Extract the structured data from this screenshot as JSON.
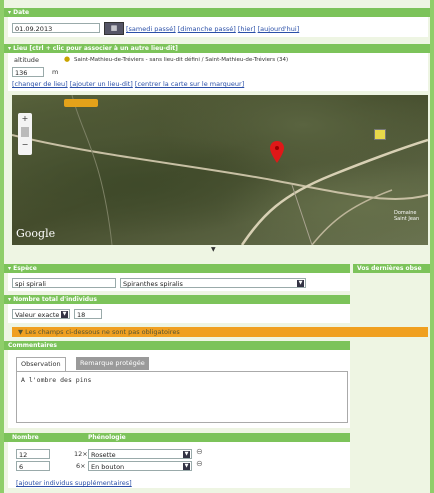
{
  "date": {
    "header": "Date",
    "value": "01.09.2013",
    "links": [
      "[samedi passé]",
      "[dimanche passé]",
      "[hier]",
      "[aujourd'hui]"
    ]
  },
  "location": {
    "header": "Lieu [ctrl + clic pour associer à un autre lieu-dit]",
    "altitude_label": "altitude",
    "altitude_value": "136",
    "altitude_unit": "m",
    "place_text": "Saint-Mathieu-de-Tréviers - sans lieu-dit défini / Saint-Mathieu-de-Tréviers (34)",
    "links": [
      "[changer de lieu]",
      "[ajouter un lieu-dit]",
      "[centrer la carte sur le marqueur]"
    ],
    "map_brand": "Google",
    "map_label": "Domaine Saint Jean"
  },
  "species": {
    "header": "Espèce",
    "input_value": "spi spirali",
    "select_value": "Spiranthes spiralis",
    "side_header": "Vos dernières obse"
  },
  "count": {
    "header": "Nombre total d'individus",
    "type_value": "Valeur exacte",
    "number_value": "18"
  },
  "optional_notice": "Les champs ci-dessous ne sont pas obligatoires",
  "comments": {
    "header": "Commentaires",
    "tabs": [
      "Observation",
      "Remarque protégée"
    ],
    "text": "A l'ombre des pins"
  },
  "stages": {
    "col_number": "Nombre",
    "col_phenology": "Phénologie",
    "rows": [
      {
        "count": "12",
        "unit": "12×",
        "stage": "Rosette"
      },
      {
        "count": "6",
        "unit": "6×",
        "stage": "En bouton"
      }
    ],
    "add_link": "[ajouter individus supplémentaires]"
  },
  "colors": {
    "accent": "#7cc35a",
    "notice": "#f0a020",
    "link": "#2a4fa8",
    "marker": "#e01818"
  }
}
